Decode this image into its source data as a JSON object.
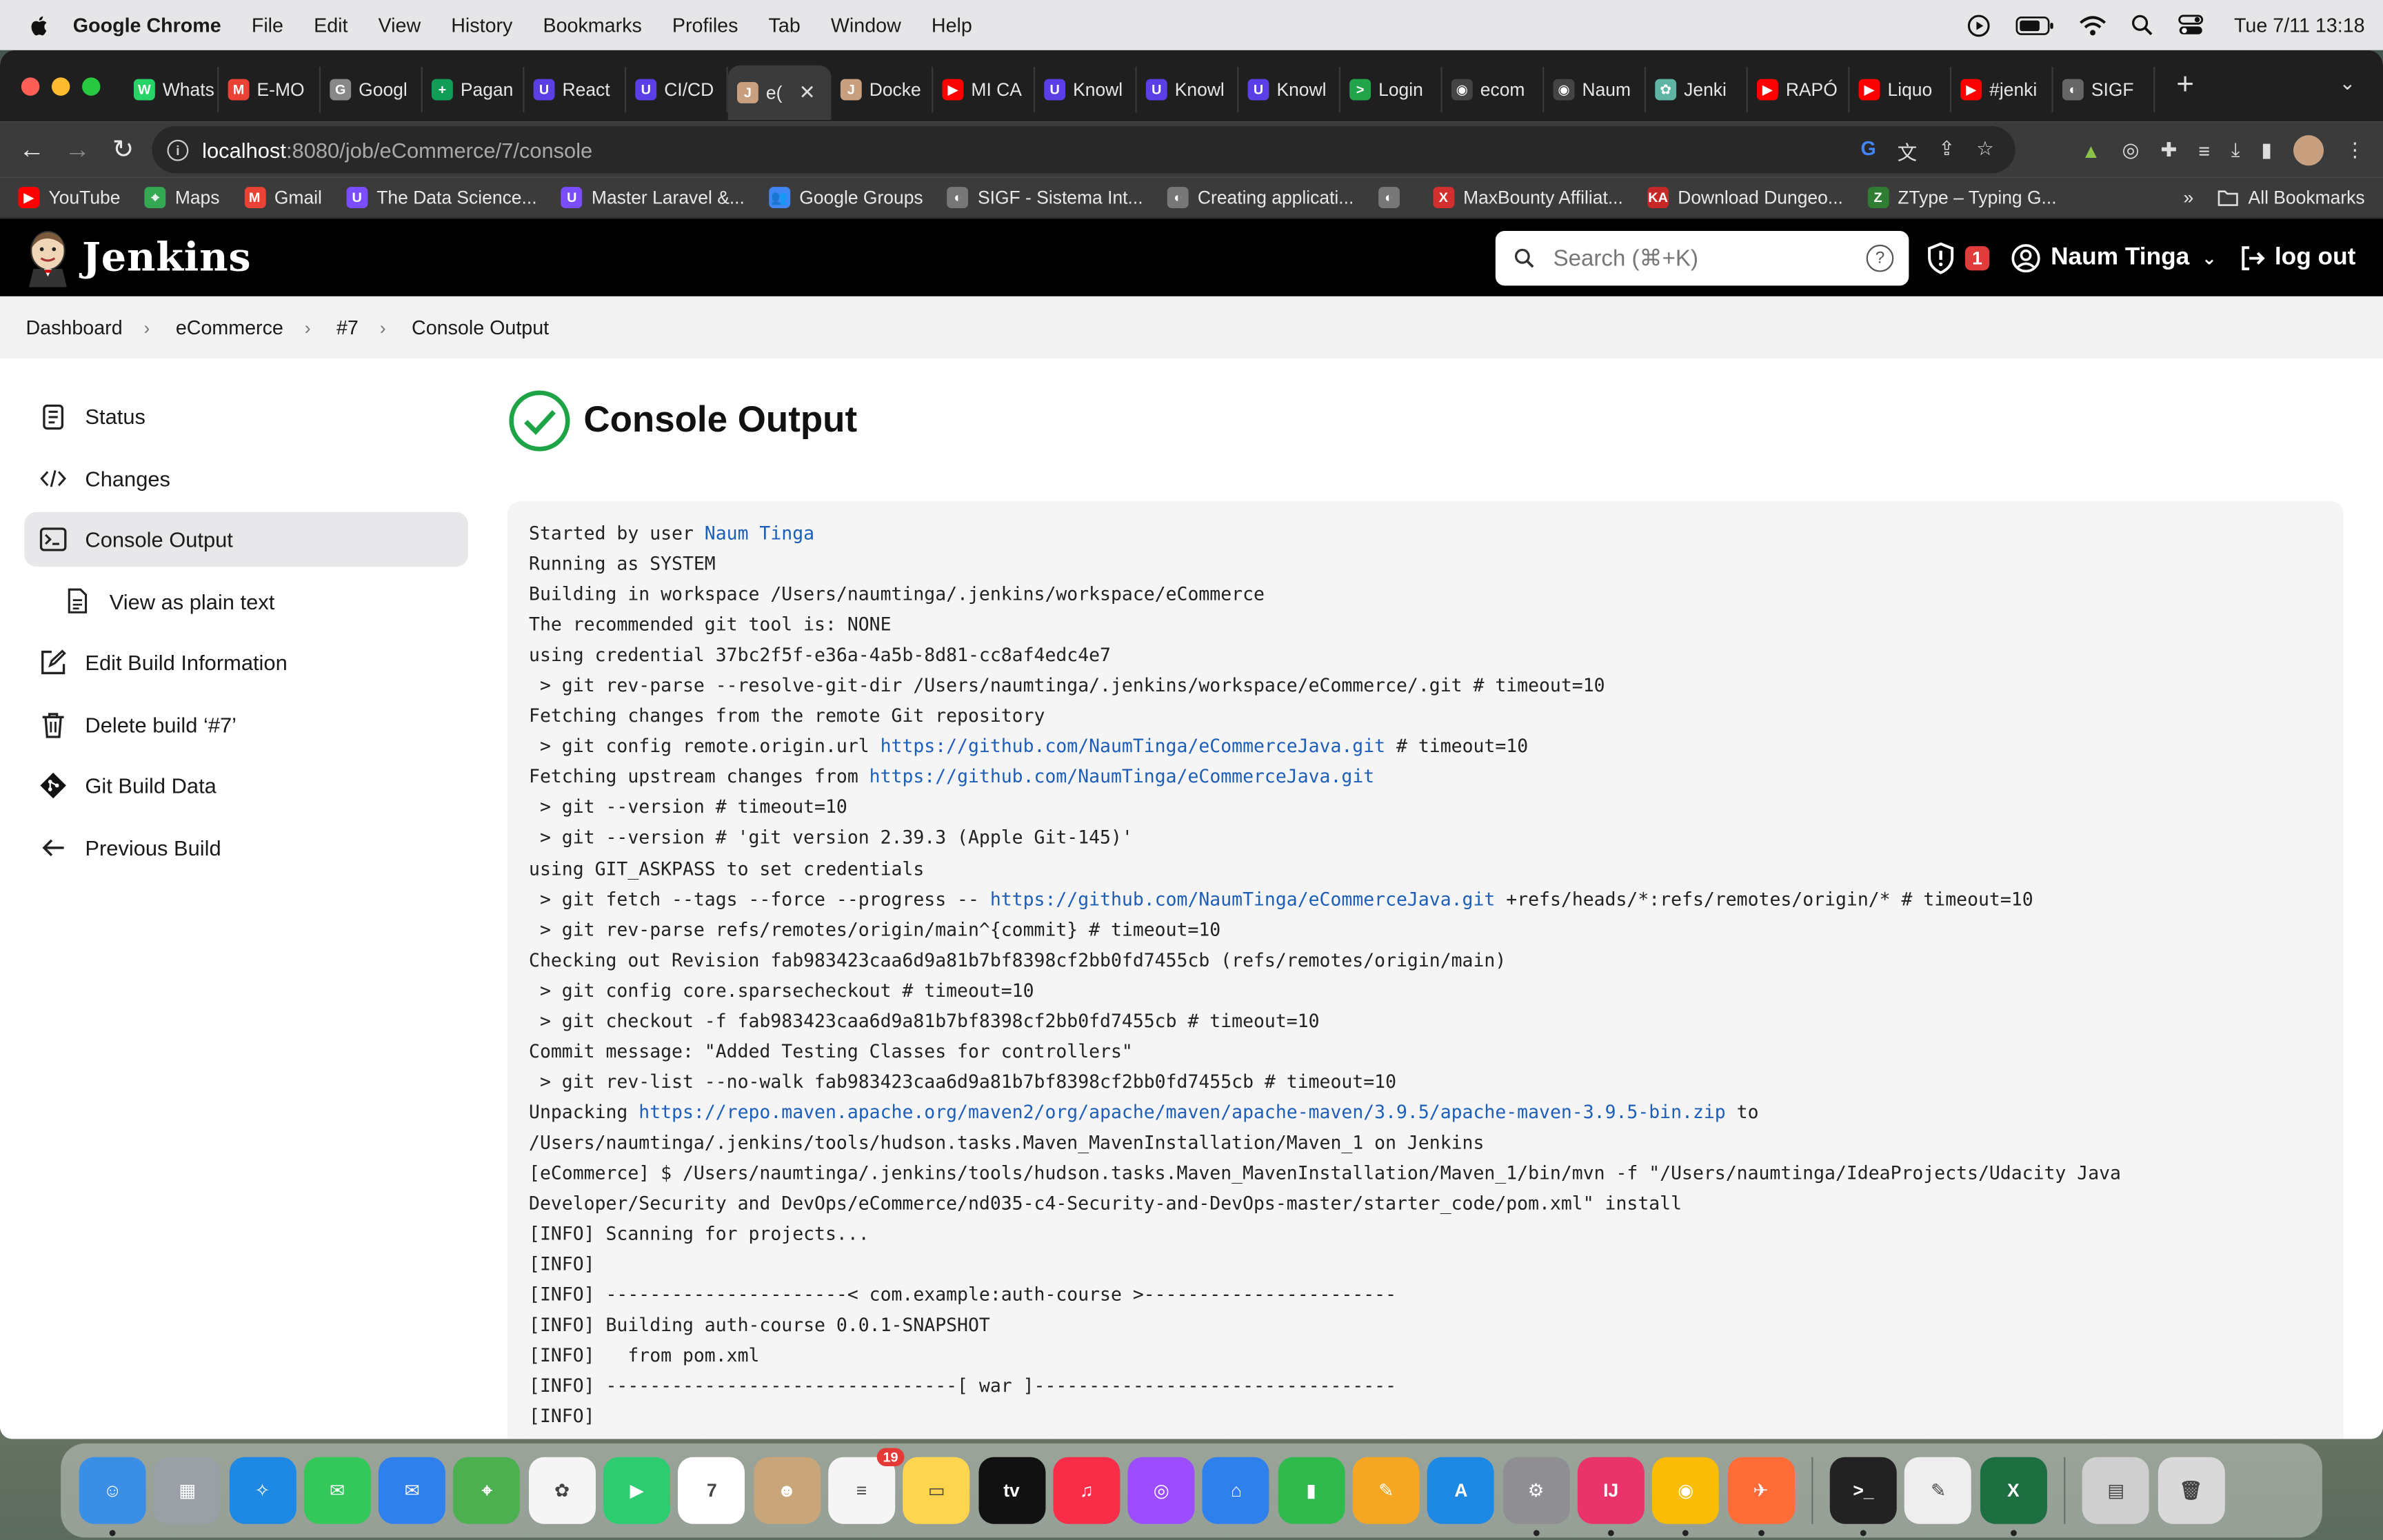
{
  "menubar": {
    "app_name": "Google Chrome",
    "items": [
      "File",
      "Edit",
      "View",
      "History",
      "Bookmarks",
      "Profiles",
      "Tab",
      "Window",
      "Help"
    ],
    "clock": "Tue 7/11  13:18"
  },
  "tabs": [
    {
      "label": "Whats",
      "color": "#25d366",
      "glyph": "W"
    },
    {
      "label": "E-MO",
      "color": "#ea4335",
      "glyph": "M"
    },
    {
      "label": "Googl",
      "color": "#888888",
      "glyph": "G"
    },
    {
      "label": "Pagan",
      "color": "#0f9d58",
      "glyph": "+"
    },
    {
      "label": "React",
      "color": "#5b3ee6",
      "glyph": "U"
    },
    {
      "label": "CI/CD",
      "color": "#5b3ee6",
      "glyph": "U"
    },
    {
      "label": "e(",
      "color": "#c9a07f",
      "glyph": "J",
      "active": true
    },
    {
      "label": "Docke",
      "color": "#c9a07f",
      "glyph": "J"
    },
    {
      "label": "MI CA",
      "color": "#ff0000",
      "glyph": "▶"
    },
    {
      "label": "Knowl",
      "color": "#5b3ee6",
      "glyph": "U"
    },
    {
      "label": "Knowl",
      "color": "#5b3ee6",
      "glyph": "U"
    },
    {
      "label": "Knowl",
      "color": "#5b3ee6",
      "glyph": "U"
    },
    {
      "label": "Login",
      "color": "#22a54a",
      "glyph": ">"
    },
    {
      "label": "ecom",
      "color": "#444444",
      "glyph": "◉"
    },
    {
      "label": "Naum",
      "color": "#444444",
      "glyph": "◉"
    },
    {
      "label": "Jenki",
      "color": "#5fb3a3",
      "glyph": "✿"
    },
    {
      "label": "RAPÓ",
      "color": "#ff0000",
      "glyph": "▶"
    },
    {
      "label": "Liquo",
      "color": "#ff0000",
      "glyph": "▶"
    },
    {
      "label": "#jenki",
      "color": "#ff0000",
      "glyph": "▶"
    },
    {
      "label": "SIGF",
      "color": "#666666",
      "glyph": "◐"
    }
  ],
  "address": {
    "host": "localhost",
    "rest": ":8080/job/eCommerce/7/console"
  },
  "bookmarks": [
    {
      "label": "YouTube",
      "color": "#ff0000",
      "glyph": "▶"
    },
    {
      "label": "Maps",
      "color": "#34a853",
      "glyph": "⌖"
    },
    {
      "label": "Gmail",
      "color": "#ea4335",
      "glyph": "M"
    },
    {
      "label": "The Data Science...",
      "color": "#7c4dff",
      "glyph": "U"
    },
    {
      "label": "Master Laravel &...",
      "color": "#7c4dff",
      "glyph": "U"
    },
    {
      "label": "Google Groups",
      "color": "#4285f4",
      "glyph": "👥"
    },
    {
      "label": "SIGF - Sistema Int...",
      "color": "#777777",
      "glyph": "◐"
    },
    {
      "label": "Creating applicati...",
      "color": "#777777",
      "glyph": "◐"
    },
    {
      "label": "",
      "color": "#777777",
      "glyph": "◐"
    },
    {
      "label": "MaxBounty Affiliat...",
      "color": "#d32f2f",
      "glyph": "X"
    },
    {
      "label": "Download Dungeo...",
      "color": "#c62828",
      "glyph": "KA"
    },
    {
      "label": "ZType – Typing G...",
      "color": "#2e7d32",
      "glyph": "Z"
    }
  ],
  "bookmarks_more": "»",
  "all_bookmarks": "All Bookmarks",
  "jenkins": {
    "brand": "Jenkins",
    "search_placeholder": "Search (⌘+K)",
    "security_count": "1",
    "user": "Naum Tinga",
    "logout": "log out"
  },
  "breadcrumbs": [
    "Dashboard",
    "eCommerce",
    "#7",
    "Console Output"
  ],
  "sidebar": [
    {
      "label": "Status",
      "icon": "status-icon"
    },
    {
      "label": "Changes",
      "icon": "code-icon"
    },
    {
      "label": "Console Output",
      "icon": "terminal-icon",
      "active": true
    },
    {
      "label": "View as plain text",
      "icon": "document-icon",
      "sub": true
    },
    {
      "label": "Edit Build Information",
      "icon": "edit-icon"
    },
    {
      "label": "Delete build ‘#7’",
      "icon": "trash-icon"
    },
    {
      "label": "Git Build Data",
      "icon": "git-icon"
    },
    {
      "label": "Previous Build",
      "icon": "arrow-left-icon"
    }
  ],
  "page_title": "Console Output",
  "console_lines": [
    [
      {
        "t": "Started by user "
      },
      {
        "t": "Naum Tinga",
        "link": true
      }
    ],
    [
      {
        "t": "Running as SYSTEM"
      }
    ],
    [
      {
        "t": "Building in workspace /Users/naumtinga/.jenkins/workspace/eCommerce"
      }
    ],
    [
      {
        "t": "The recommended git tool is: NONE"
      }
    ],
    [
      {
        "t": "using credential 37bc2f5f-e36a-4a5b-8d81-cc8af4edc4e7"
      }
    ],
    [
      {
        "t": " > git rev-parse --resolve-git-dir /Users/naumtinga/.jenkins/workspace/eCommerce/.git # timeout=10"
      }
    ],
    [
      {
        "t": "Fetching changes from the remote Git repository"
      }
    ],
    [
      {
        "t": " > git config remote.origin.url "
      },
      {
        "t": "https://github.com/NaumTinga/eCommerceJava.git",
        "link": true
      },
      {
        "t": " # timeout=10"
      }
    ],
    [
      {
        "t": "Fetching upstream changes from "
      },
      {
        "t": "https://github.com/NaumTinga/eCommerceJava.git",
        "link": true
      }
    ],
    [
      {
        "t": " > git --version # timeout=10"
      }
    ],
    [
      {
        "t": " > git --version # 'git version 2.39.3 (Apple Git-145)'"
      }
    ],
    [
      {
        "t": "using GIT_ASKPASS to set credentials"
      }
    ],
    [
      {
        "t": " > git fetch --tags --force --progress -- "
      },
      {
        "t": "https://github.com/NaumTinga/eCommerceJava.git",
        "link": true
      },
      {
        "t": " +refs/heads/*:refs/remotes/origin/* # timeout=10"
      }
    ],
    [
      {
        "t": " > git rev-parse refs/remotes/origin/main^{commit} # timeout=10"
      }
    ],
    [
      {
        "t": "Checking out Revision fab983423caa6d9a81b7bf8398cf2bb0fd7455cb (refs/remotes/origin/main)"
      }
    ],
    [
      {
        "t": " > git config core.sparsecheckout # timeout=10"
      }
    ],
    [
      {
        "t": " > git checkout -f fab983423caa6d9a81b7bf8398cf2bb0fd7455cb # timeout=10"
      }
    ],
    [
      {
        "t": "Commit message: \"Added Testing Classes for controllers\""
      }
    ],
    [
      {
        "t": " > git rev-list --no-walk fab983423caa6d9a81b7bf8398cf2bb0fd7455cb # timeout=10"
      }
    ],
    [
      {
        "t": "Unpacking "
      },
      {
        "t": "https://repo.maven.apache.org/maven2/org/apache/maven/apache-maven/3.9.5/apache-maven-3.9.5-bin.zip",
        "link": true
      },
      {
        "t": " to"
      }
    ],
    [
      {
        "t": "/Users/naumtinga/.jenkins/tools/hudson.tasks.Maven_MavenInstallation/Maven_1 on Jenkins"
      }
    ],
    [
      {
        "t": "[eCommerce] $ /Users/naumtinga/.jenkins/tools/hudson.tasks.Maven_MavenInstallation/Maven_1/bin/mvn -f \"/Users/naumtinga/IdeaProjects/Udacity Java"
      }
    ],
    [
      {
        "t": "Developer/Security and DevOps/eCommerce/nd035-c4-Security-and-DevOps-master/starter_code/pom.xml\" install"
      }
    ],
    [
      {
        "t": "[INFO] Scanning for projects..."
      }
    ],
    [
      {
        "t": "[INFO]"
      }
    ],
    [
      {
        "t": "[INFO] ----------------------< com.example:auth-course >-----------------------"
      }
    ],
    [
      {
        "t": "[INFO] Building auth-course 0.0.1-SNAPSHOT"
      }
    ],
    [
      {
        "t": "[INFO]   from pom.xml"
      }
    ],
    [
      {
        "t": "[INFO] --------------------------------[ war ]---------------------------------"
      }
    ],
    [
      {
        "t": "[INFO]"
      }
    ]
  ],
  "dock": [
    {
      "name": "finder",
      "color": "#3a8ee6",
      "glyph": "☺",
      "running": true
    },
    {
      "name": "launchpad",
      "color": "#9aa0a6",
      "glyph": "▦"
    },
    {
      "name": "safari",
      "color": "#1e88e5",
      "glyph": "✧"
    },
    {
      "name": "messages",
      "color": "#34c759",
      "glyph": "✉"
    },
    {
      "name": "mail",
      "color": "#2f80ed",
      "glyph": "✉"
    },
    {
      "name": "maps",
      "color": "#4caf50",
      "glyph": "⌖"
    },
    {
      "name": "photos",
      "color": "#f5f5f5",
      "glyph": "✿"
    },
    {
      "name": "facetime",
      "color": "#2ecc71",
      "glyph": "▶"
    },
    {
      "name": "calendar",
      "color": "#ffffff",
      "glyph": "7"
    },
    {
      "name": "contacts",
      "color": "#c9a57a",
      "glyph": "☻"
    },
    {
      "name": "reminders",
      "color": "#f5f5f5",
      "glyph": "≡",
      "badge": "19"
    },
    {
      "name": "notes",
      "color": "#ffd54f",
      "glyph": "▭"
    },
    {
      "name": "tv",
      "color": "#111111",
      "glyph": "tv"
    },
    {
      "name": "music",
      "color": "#fa2d48",
      "glyph": "♫"
    },
    {
      "name": "podcasts",
      "color": "#9b4dff",
      "glyph": "◎"
    },
    {
      "name": "keynote",
      "color": "#2f80ed",
      "glyph": "⌂"
    },
    {
      "name": "numbers",
      "color": "#30b94d",
      "glyph": "▮"
    },
    {
      "name": "pages",
      "color": "#f5a623",
      "glyph": "✎"
    },
    {
      "name": "app-store",
      "color": "#1e88e5",
      "glyph": "A"
    },
    {
      "name": "system-settings",
      "color": "#8e8e93",
      "glyph": "⚙",
      "running": true
    },
    {
      "name": "intellij",
      "color": "#e8336b",
      "glyph": "IJ",
      "running": true
    },
    {
      "name": "chrome",
      "color": "#fbbc05",
      "glyph": "◉",
      "running": true
    },
    {
      "name": "postman",
      "color": "#ff6c37",
      "glyph": "✈",
      "running": true
    },
    {
      "name": "terminal",
      "color": "#222222",
      "glyph": ">_",
      "running": true
    },
    {
      "name": "textedit",
      "color": "#eeeeee",
      "glyph": "✎"
    },
    {
      "name": "excel",
      "color": "#1d6f42",
      "glyph": "X",
      "running": true
    },
    {
      "name": "documents",
      "color": "#cfcfcf",
      "glyph": "▤"
    },
    {
      "name": "trash",
      "color": "#d9d9d9",
      "glyph": "🗑"
    }
  ]
}
